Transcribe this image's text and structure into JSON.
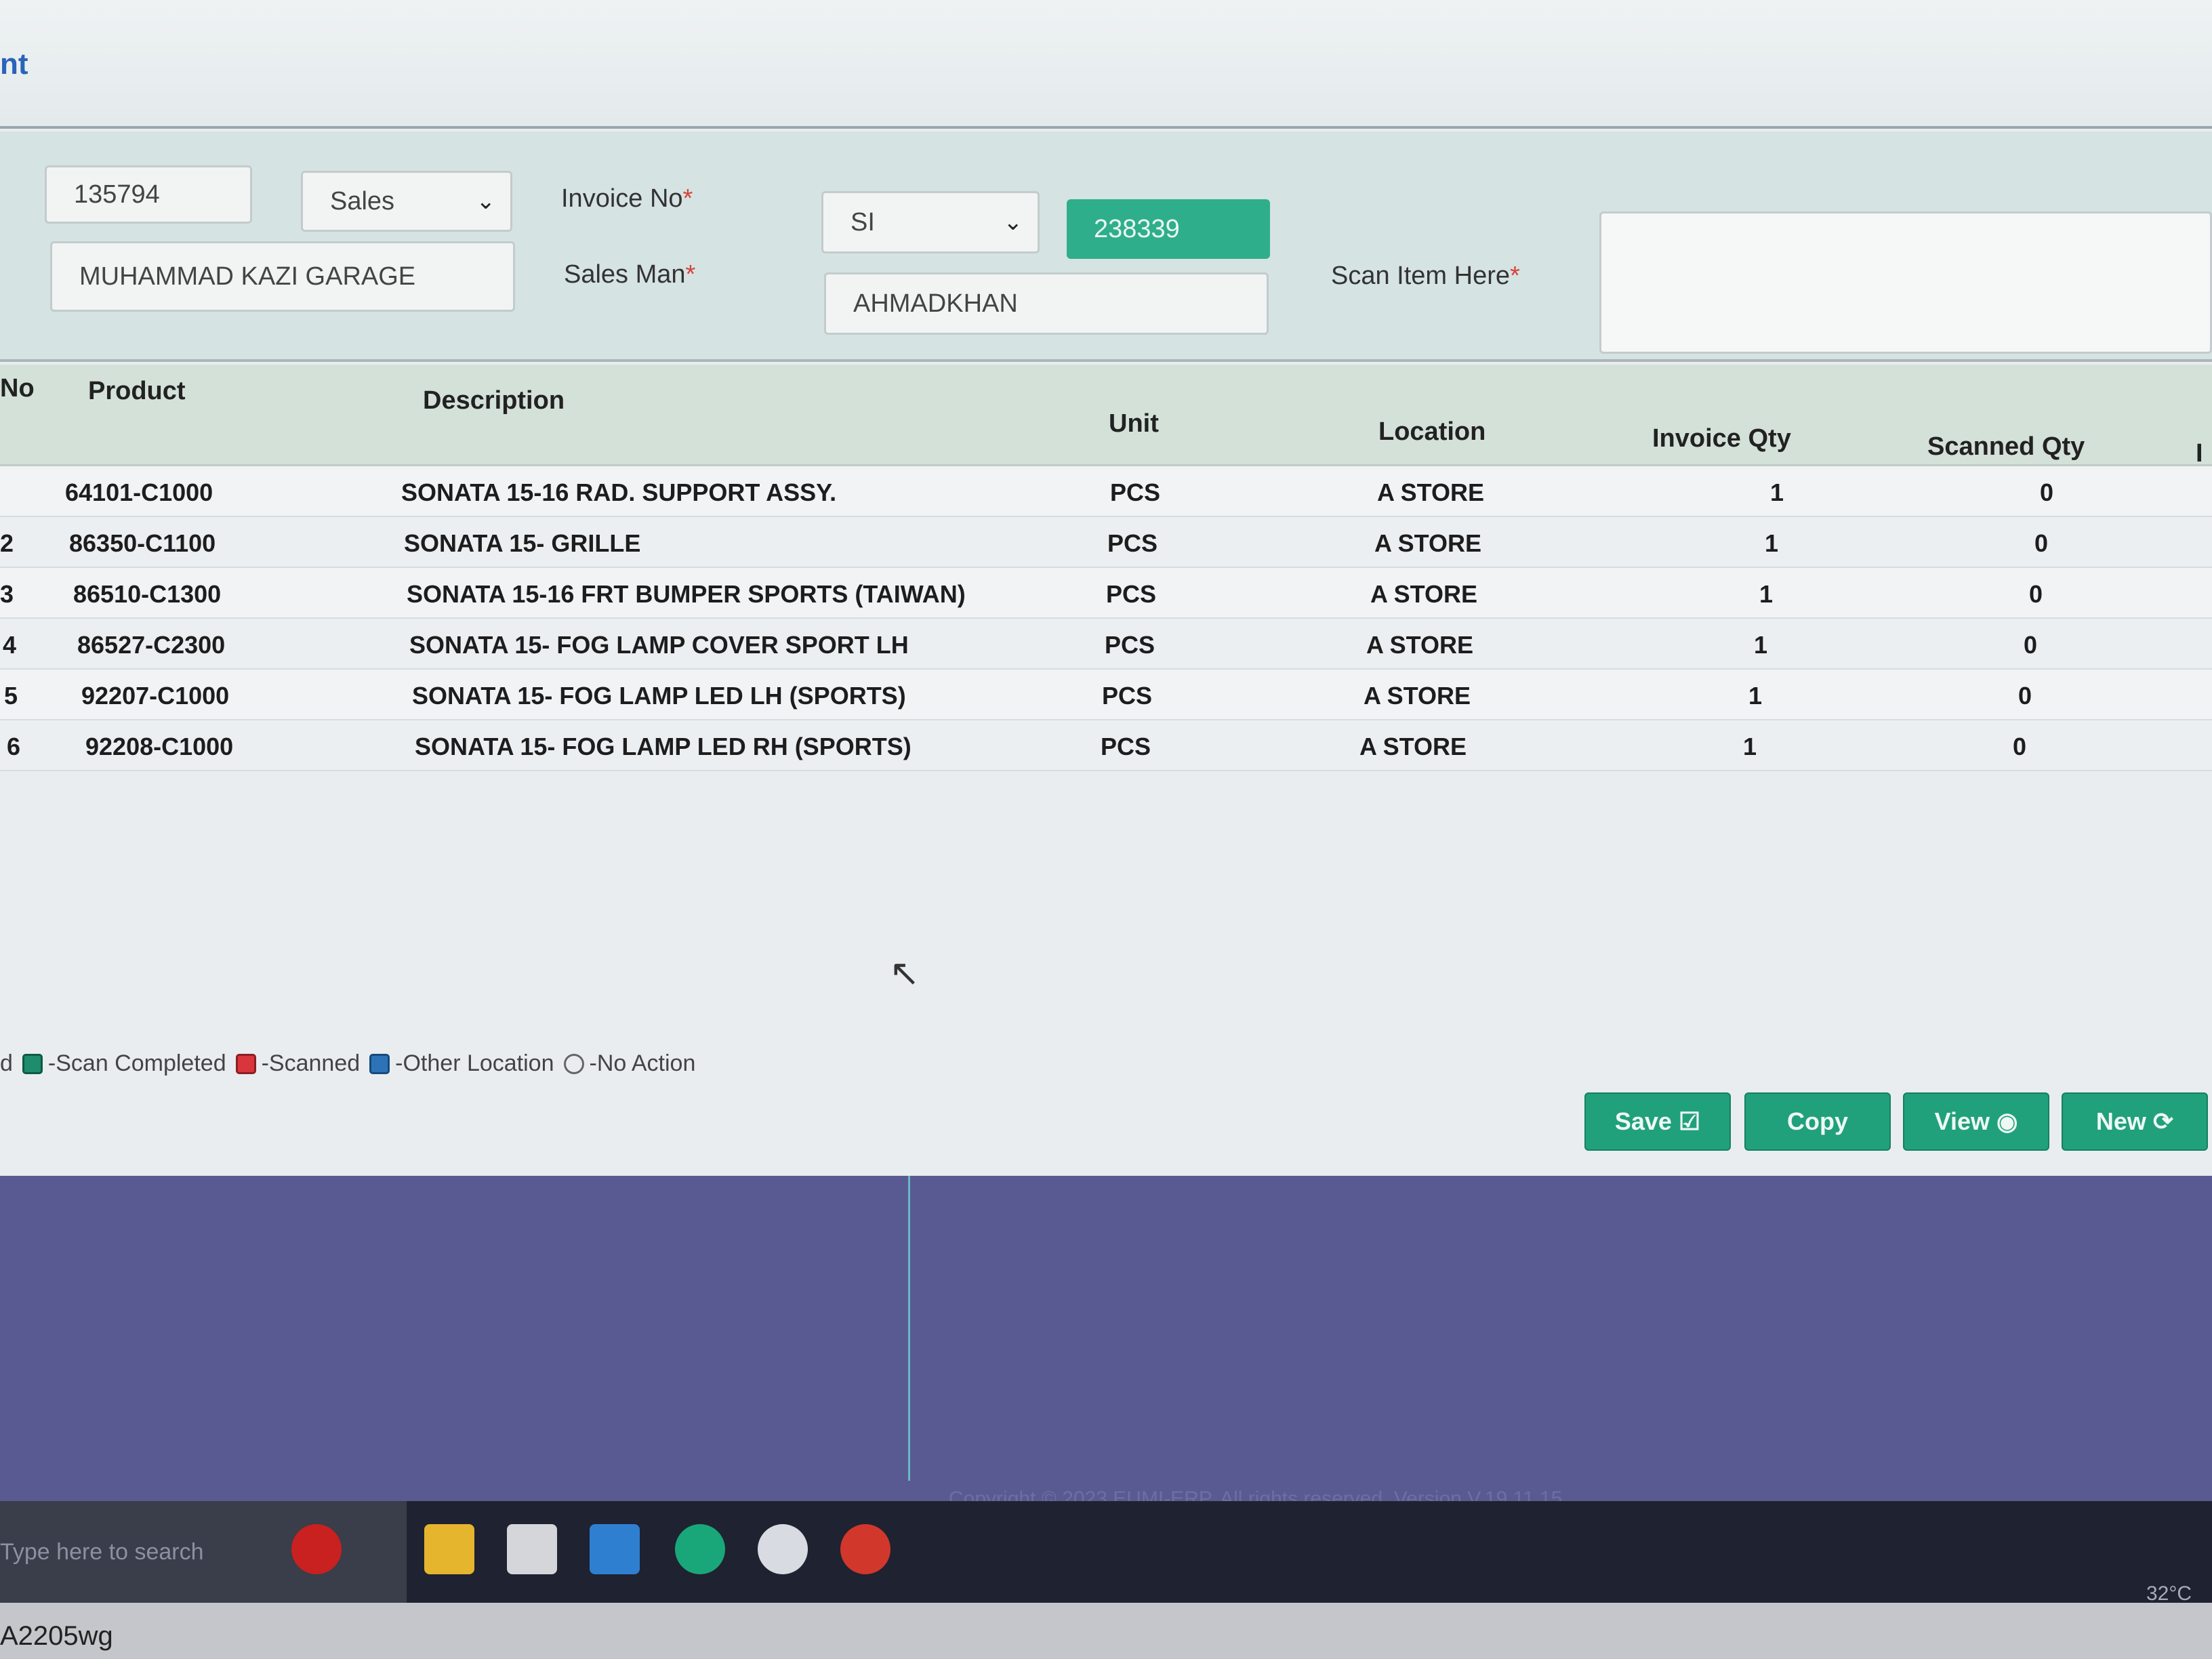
{
  "page": {
    "heading": "nt"
  },
  "form": {
    "customer_code": "135794",
    "type_select": "Sales",
    "customer_name": "MUHAMMAD KAZI GARAGE",
    "invoice_label": "Invoice No",
    "invoice_prefix_select": "SI",
    "invoice_number": "238339",
    "salesman_label": "Sales Man",
    "salesman_value": "AHMADKHAN",
    "scan_label": "Scan Item Here",
    "required_mark": "*"
  },
  "table": {
    "headers": {
      "no": "No",
      "product": "Product",
      "description": "Description",
      "unit": "Unit",
      "location": "Location",
      "invoice_qty": "Invoice Qty",
      "scanned_qty": "Scanned Qty",
      "extra": "I"
    },
    "rows": [
      {
        "no": "",
        "product": "64101-C1000",
        "description": "SONATA 15-16 RAD. SUPPORT ASSY.",
        "unit": "PCS",
        "location": "A STORE",
        "invoice_qty": "1",
        "scanned_qty": "0"
      },
      {
        "no": "2",
        "product": "86350-C1100",
        "description": "SONATA 15- GRILLE",
        "unit": "PCS",
        "location": "A STORE",
        "invoice_qty": "1",
        "scanned_qty": "0"
      },
      {
        "no": "3",
        "product": "86510-C1300",
        "description": "SONATA 15-16 FRT BUMPER SPORTS (TAIWAN)",
        "unit": "PCS",
        "location": "A STORE",
        "invoice_qty": "1",
        "scanned_qty": "0"
      },
      {
        "no": "4",
        "product": "86527-C2300",
        "description": "SONATA 15- FOG LAMP COVER SPORT LH",
        "unit": "PCS",
        "location": "A STORE",
        "invoice_qty": "1",
        "scanned_qty": "0"
      },
      {
        "no": "5",
        "product": "92207-C1000",
        "description": "SONATA 15- FOG LAMP LED LH (SPORTS)",
        "unit": "PCS",
        "location": "A STORE",
        "invoice_qty": "1",
        "scanned_qty": "0"
      },
      {
        "no": "6",
        "product": "92208-C1000",
        "description": "SONATA 15- FOG LAMP LED RH (SPORTS)",
        "unit": "PCS",
        "location": "A STORE",
        "invoice_qty": "1",
        "scanned_qty": "0"
      }
    ]
  },
  "legend": {
    "lead": "d",
    "scan_completed": "-Scan Completed",
    "scanned": "-Scanned",
    "other_location": "-Other Location",
    "no_action": "-No Action"
  },
  "buttons": {
    "save": "Save",
    "copy": "Copy",
    "view": "View",
    "new": "New"
  },
  "footer": {
    "copyright": "Copyright © 2023 EUMI-ERP. All rights reserved. Version V.19.11.15"
  },
  "taskbar": {
    "search_placeholder": "Type here to search",
    "temperature": "32°C"
  },
  "bottom_text": "A2205wg",
  "colors": {
    "accent_green": "#21a07c",
    "form_bg": "#d5e3e2",
    "footer_band": "#5a5a92"
  }
}
